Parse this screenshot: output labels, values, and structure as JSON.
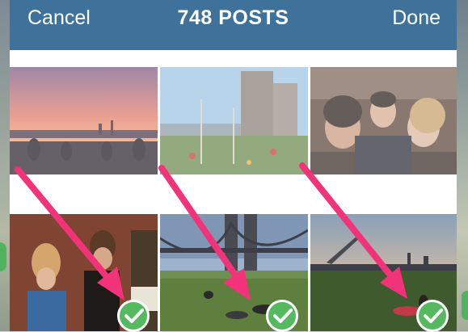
{
  "header": {
    "cancel_label": "Cancel",
    "title": "748 POSTS",
    "done_label": "Done",
    "bar_color": "#3f729b"
  },
  "grid": {
    "rows": [
      {
        "items": [
          {
            "photo": "sunset-skyline",
            "selected": false
          },
          {
            "photo": "city-garden",
            "selected": false
          },
          {
            "photo": "friends-laughing",
            "selected": false
          }
        ]
      },
      {
        "items": [
          {
            "photo": "two-women-drinks",
            "selected": true
          },
          {
            "photo": "bridge-park",
            "selected": true
          },
          {
            "photo": "park-sunset-skyline",
            "selected": true
          }
        ]
      }
    ]
  },
  "colors": {
    "check_green": "#55b95f",
    "arrow_pink": "#f2337a"
  },
  "icons": [
    "check-icon",
    "arrow-annotation"
  ]
}
